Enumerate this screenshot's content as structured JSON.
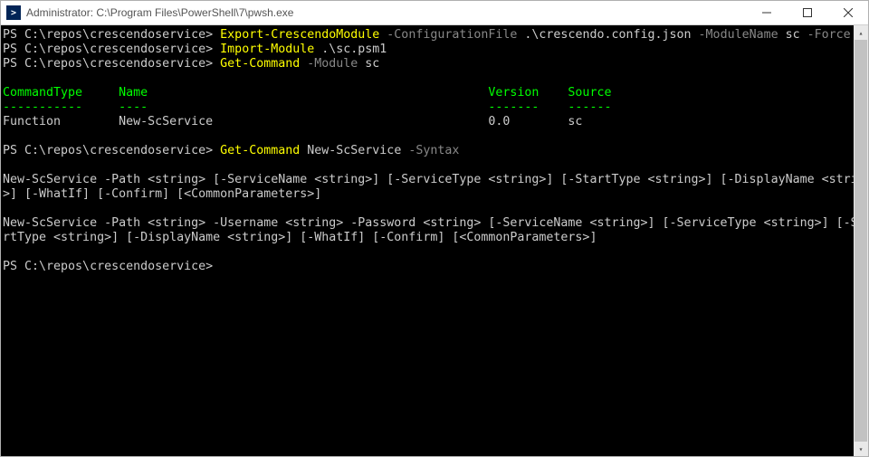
{
  "titlebar": {
    "title": "Administrator: C:\\Program Files\\PowerShell\\7\\pwsh.exe"
  },
  "terminal": {
    "lines": [
      {
        "segments": [
          {
            "cls": "white",
            "text": "PS C:\\repos\\crescendoservice> "
          },
          {
            "cls": "yellow",
            "text": "Export-CrescendoModule "
          },
          {
            "cls": "gray",
            "text": "-ConfigurationFile "
          },
          {
            "cls": "white",
            "text": ".\\crescendo.config.json "
          },
          {
            "cls": "gray",
            "text": "-ModuleName "
          },
          {
            "cls": "white",
            "text": "sc "
          },
          {
            "cls": "gray",
            "text": "-Force"
          }
        ]
      },
      {
        "segments": [
          {
            "cls": "white",
            "text": "PS C:\\repos\\crescendoservice> "
          },
          {
            "cls": "yellow",
            "text": "Import-Module "
          },
          {
            "cls": "white",
            "text": ".\\sc.psm1"
          }
        ]
      },
      {
        "segments": [
          {
            "cls": "white",
            "text": "PS C:\\repos\\crescendoservice> "
          },
          {
            "cls": "yellow",
            "text": "Get-Command "
          },
          {
            "cls": "gray",
            "text": "-Module "
          },
          {
            "cls": "white",
            "text": "sc"
          }
        ]
      },
      {
        "segments": [
          {
            "cls": "white",
            "text": " "
          }
        ]
      },
      {
        "segments": [
          {
            "cls": "green",
            "text": "CommandType     Name                                               Version    Source"
          }
        ]
      },
      {
        "segments": [
          {
            "cls": "green",
            "text": "-----------     ----                                               -------    ------"
          }
        ]
      },
      {
        "segments": [
          {
            "cls": "white",
            "text": "Function        New-ScService                                      0.0        sc"
          }
        ]
      },
      {
        "segments": [
          {
            "cls": "white",
            "text": " "
          }
        ]
      },
      {
        "segments": [
          {
            "cls": "white",
            "text": "PS C:\\repos\\crescendoservice> "
          },
          {
            "cls": "yellow",
            "text": "Get-Command "
          },
          {
            "cls": "white",
            "text": "New-ScService "
          },
          {
            "cls": "gray",
            "text": "-Syntax"
          }
        ]
      },
      {
        "segments": [
          {
            "cls": "white",
            "text": " "
          }
        ]
      },
      {
        "segments": [
          {
            "cls": "white",
            "text": "New-ScService -Path <string> [-ServiceName <string>] [-ServiceType <string>] [-StartType <string>] [-DisplayName <string"
          }
        ]
      },
      {
        "segments": [
          {
            "cls": "white",
            "text": ">] [-WhatIf] [-Confirm] [<CommonParameters>]"
          }
        ]
      },
      {
        "segments": [
          {
            "cls": "white",
            "text": " "
          }
        ]
      },
      {
        "segments": [
          {
            "cls": "white",
            "text": "New-ScService -Path <string> -Username <string> -Password <string> [-ServiceName <string>] [-ServiceType <string>] [-Sta"
          }
        ]
      },
      {
        "segments": [
          {
            "cls": "white",
            "text": "rtType <string>] [-DisplayName <string>] [-WhatIf] [-Confirm] [<CommonParameters>]"
          }
        ]
      },
      {
        "segments": [
          {
            "cls": "white",
            "text": " "
          }
        ]
      },
      {
        "segments": [
          {
            "cls": "white",
            "text": "PS C:\\repos\\crescendoservice>"
          }
        ]
      }
    ]
  }
}
